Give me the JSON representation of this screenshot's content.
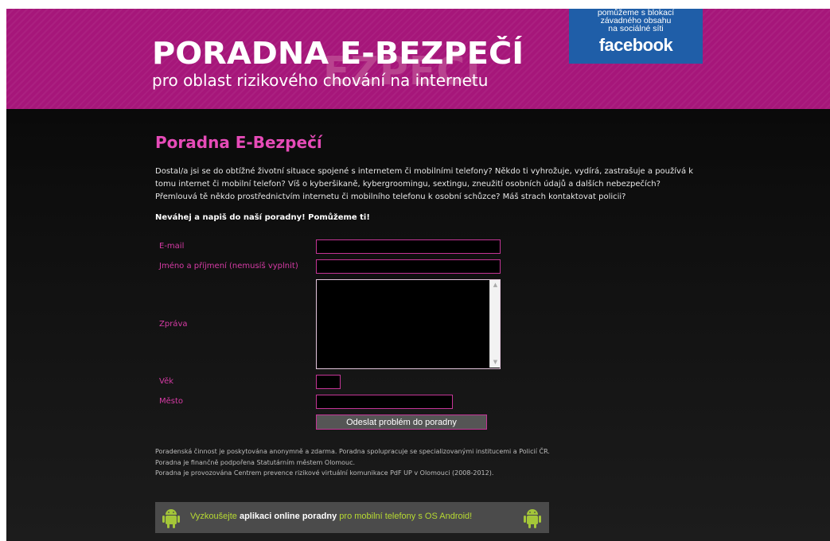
{
  "header": {
    "watermark": "EZPEČÍ",
    "title": "PORADNA E-BEZPEČÍ",
    "subtitle": "pro oblast rizikového chování na internetu",
    "facebook_banner": {
      "line1": "pomůžeme s blokací",
      "line2": "závadného obsahu",
      "line3": "na sociálné síti",
      "brand": "facebook"
    }
  },
  "main": {
    "heading": "Poradna E-Bezpečí",
    "intro": "Dostal/a jsi se do obtížné životní situace spojené s internetem či mobilními telefony? Někdo ti vyhrožuje, vydírá, zastrašuje a používá k tomu internet či mobilní telefon? Víš o kyberšikaně, kybergroomingu, sextingu, zneužití osobních údajů a dalších nebezpečích? Přemlouvá tě někdo prostřednictvím internetu či mobilního telefonu k osobní schůzce? Máš strach kontaktovat policii?",
    "cta": "Neváhej a napiš do naší poradny! Pomůžeme ti!"
  },
  "form": {
    "email_label": "E-mail",
    "email_value": "",
    "name_label": "Jméno a příjmení (nemusíš vyplnit)",
    "name_value": "",
    "message_label": "Zpráva",
    "message_value": "",
    "age_label": "Věk",
    "age_value": "",
    "city_label": "Město",
    "city_value": "",
    "submit_label": "Odeslat problém do poradny"
  },
  "footer": {
    "line1": "Poradenská činnost je poskytována anonymně a zdarma. Poradna spolupracuje se specializovanými institucemi a Policií ČR.",
    "line2": "Poradna je finančně podpořena Statutárním městem Olomouc.",
    "line3": "Poradna je provozována Centrem prevence rizikové virtuální komunikace PdF UP v Olomouci (2008-2012)."
  },
  "android_banner": {
    "prefix": "Vyzkoušejte ",
    "bold": "aplikaci online poradny",
    "suffix": " pro mobilní telefony s OS Android!",
    "icon": "android-icon"
  },
  "colors": {
    "header_bg": "#a6167a",
    "accent_pink": "#e64bb8",
    "facebook_blue": "#1f5ea8",
    "android_green": "#b7da32"
  }
}
